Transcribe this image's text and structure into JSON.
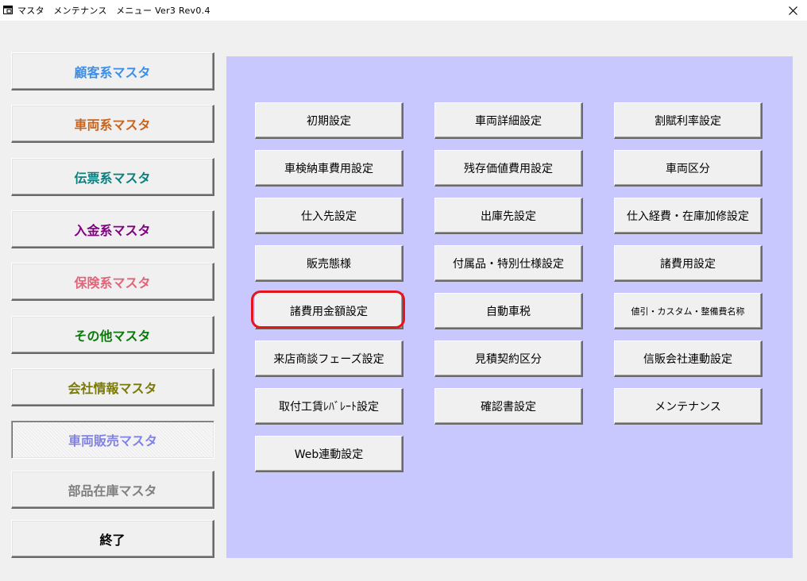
{
  "window": {
    "title": "マスタ　メンテナンス　メニュー Ver3 Rev0.4",
    "app_icon": "app-window-icon",
    "close_icon": "close-icon"
  },
  "sidebar": {
    "items": [
      {
        "label": "顧客系マスタ",
        "color": "#3c8fe8"
      },
      {
        "label": "車両系マスタ",
        "color": "#c8641e"
      },
      {
        "label": "伝票系マスタ",
        "color": "#0a8080"
      },
      {
        "label": "入金系マスタ",
        "color": "#820082"
      },
      {
        "label": "保険系マスタ",
        "color": "#e26478"
      },
      {
        "label": "その他マスタ",
        "color": "#0a7a0a"
      },
      {
        "label": "会社情報マスタ",
        "color": "#7a7a0a"
      },
      {
        "label": "車両販売マスタ",
        "color": "#8282e6",
        "selected": true
      },
      {
        "label": "部品在庫マスタ",
        "color": "#808080"
      },
      {
        "label": "終了",
        "color": "#000000"
      }
    ]
  },
  "main": {
    "panel_color": "#c8c8ff",
    "buttons": [
      {
        "label": "初期設定"
      },
      {
        "label": "車両詳細設定"
      },
      {
        "label": "割賦利率設定"
      },
      {
        "label": "車検納車費用設定"
      },
      {
        "label": "残存価値費用設定"
      },
      {
        "label": "車両区分"
      },
      {
        "label": "仕入先設定"
      },
      {
        "label": "出庫先設定"
      },
      {
        "label": "仕入経費・在庫加修設定"
      },
      {
        "label": "販売態様"
      },
      {
        "label": "付属品・特別仕様設定"
      },
      {
        "label": "諸費用設定"
      },
      {
        "label": "諸費用金額設定",
        "highlighted": true
      },
      {
        "label": "自動車税"
      },
      {
        "label": "値引・カスタム・整備費名称"
      },
      {
        "label": "来店商談フェーズ設定"
      },
      {
        "label": "見積契約区分"
      },
      {
        "label": "信販会社連動設定"
      },
      {
        "label": "取付工賃ﾚﾊﾞﾚｰﾄ設定"
      },
      {
        "label": "確認書設定"
      },
      {
        "label": "メンテナンス"
      },
      {
        "label": "Web連動設定"
      }
    ],
    "highlight_color": "#e8141c"
  }
}
